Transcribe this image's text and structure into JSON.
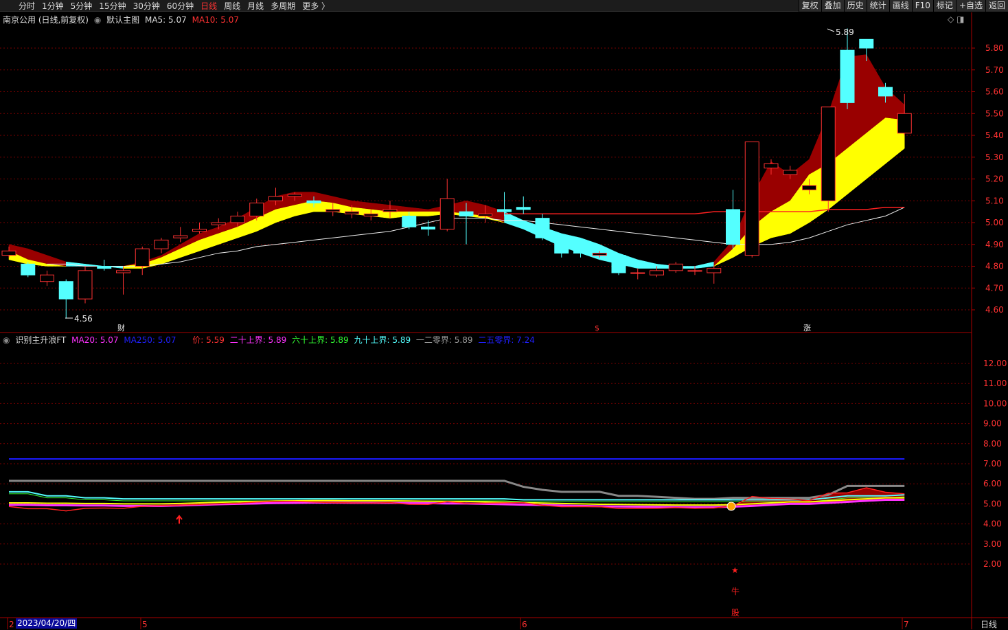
{
  "toolbar": {
    "left": [
      "分时",
      "1分钟",
      "5分钟",
      "15分钟",
      "30分钟",
      "60分钟",
      "日线",
      "周线",
      "月线",
      "多周期",
      "更多 〉"
    ],
    "active": "日线",
    "right": [
      "复权",
      "叠加",
      "历史",
      "统计",
      "画线",
      "F10",
      "标记",
      "+自选",
      "返回"
    ]
  },
  "main": {
    "stock": "南京公用 (日线,前复权)",
    "template": "默认主图",
    "ma5": "MA5: 5.07",
    "ma10": "MA10: 5.07",
    "high_label": "5.89",
    "low_label": "4.56",
    "markers": [
      "财",
      "$",
      "涨"
    ]
  },
  "indicator": {
    "name": "识别主升浪FT",
    "ma20": "MA20: 5.07",
    "ma250": "MA250: 5.07",
    "price": "价: 5.59",
    "l20": "二十上界: 5.89",
    "l60": "六十上界: 5.89",
    "l90": "九十上界: 5.89",
    "l120": "一二零界: 5.89",
    "l250": "二五零界: 7.24",
    "signals": [
      "★",
      "牛",
      "股"
    ]
  },
  "axis": {
    "date": "2023/04/20/四",
    "months": [
      "2",
      "5",
      "6",
      "7"
    ],
    "period": "日线"
  },
  "colors": {
    "up": "#ff3232",
    "down": "#54ffff",
    "band_up": "#990000",
    "band_mid": "#ffff00",
    "grid": "#7a0000"
  },
  "chart_data": {
    "type": "candlestick",
    "price_ticks": [
      "5.80",
      "5.70",
      "5.60",
      "5.50",
      "5.40",
      "5.30",
      "5.20",
      "5.10",
      "5.00",
      "4.90",
      "4.80",
      "4.70",
      "4.60"
    ],
    "ind_ticks": [
      "12.00",
      "11.00",
      "10.00",
      "9.00",
      "8.00",
      "7.00",
      "6.00",
      "5.00",
      "4.00",
      "3.00",
      "2.00"
    ],
    "ohlc": [
      [
        4.85,
        4.87,
        4.89,
        4.84
      ],
      [
        4.81,
        4.76,
        4.82,
        4.75
      ],
      [
        4.73,
        4.76,
        4.78,
        4.71
      ],
      [
        4.73,
        4.65,
        4.74,
        4.56
      ],
      [
        4.65,
        4.78,
        4.8,
        4.63
      ],
      [
        4.8,
        4.79,
        4.83,
        4.78
      ],
      [
        4.77,
        4.78,
        4.8,
        4.67
      ],
      [
        4.8,
        4.88,
        4.89,
        4.76
      ],
      [
        4.88,
        4.92,
        4.93,
        4.86
      ],
      [
        4.93,
        4.94,
        4.98,
        4.91
      ],
      [
        4.96,
        4.97,
        5.0,
        4.95
      ],
      [
        4.99,
        5.0,
        5.02,
        4.97
      ],
      [
        5.0,
        5.03,
        5.05,
        4.98
      ],
      [
        5.03,
        5.09,
        5.11,
        5.01
      ],
      [
        5.1,
        5.12,
        5.16,
        5.08
      ],
      [
        5.12,
        5.13,
        5.14,
        5.1
      ],
      [
        5.1,
        5.09,
        5.12,
        5.07
      ],
      [
        5.05,
        5.06,
        5.09,
        5.03
      ],
      [
        5.04,
        5.05,
        5.08,
        5.02
      ],
      [
        5.03,
        5.04,
        5.06,
        5.01
      ],
      [
        5.05,
        5.06,
        5.1,
        5.02
      ],
      [
        5.03,
        4.98,
        5.05,
        4.97
      ],
      [
        4.98,
        4.97,
        5.01,
        4.94
      ],
      [
        4.97,
        5.11,
        5.2,
        4.96
      ],
      [
        5.05,
        5.03,
        5.09,
        4.9
      ],
      [
        5.03,
        5.04,
        5.08,
        5.0
      ],
      [
        5.06,
        5.05,
        5.14,
        5.03
      ],
      [
        5.07,
        5.06,
        5.12,
        5.04
      ],
      [
        5.02,
        4.93,
        5.04,
        4.92
      ],
      [
        4.91,
        4.86,
        4.92,
        4.84
      ],
      [
        4.9,
        4.86,
        4.9,
        4.84
      ],
      [
        4.85,
        4.86,
        4.87,
        4.84
      ],
      [
        4.85,
        4.77,
        4.85,
        4.76
      ],
      [
        4.77,
        4.77,
        4.79,
        4.74
      ],
      [
        4.76,
        4.78,
        4.8,
        4.75
      ],
      [
        4.78,
        4.81,
        4.82,
        4.77
      ],
      [
        4.78,
        4.78,
        4.8,
        4.76
      ],
      [
        4.77,
        4.79,
        4.8,
        4.72
      ],
      [
        5.06,
        4.9,
        5.15,
        4.88
      ],
      [
        4.85,
        5.37,
        5.37,
        4.84
      ],
      [
        5.25,
        5.27,
        5.29,
        5.22
      ],
      [
        5.22,
        5.24,
        5.26,
        5.2
      ],
      [
        5.15,
        5.17,
        5.2,
        5.13
      ],
      [
        5.1,
        5.53,
        5.53,
        5.05
      ],
      [
        5.79,
        5.55,
        5.89,
        5.52
      ],
      [
        5.84,
        5.8,
        5.84,
        5.74
      ],
      [
        5.62,
        5.58,
        5.64,
        5.55
      ],
      [
        5.41,
        5.5,
        5.59,
        5.4
      ]
    ],
    "band_a": [
      4.9,
      4.88,
      4.85,
      4.82,
      4.81,
      4.8,
      4.8,
      4.82,
      4.85,
      4.9,
      4.95,
      4.98,
      5.02,
      5.07,
      5.12,
      5.14,
      5.14,
      5.12,
      5.1,
      5.09,
      5.08,
      5.07,
      5.06,
      5.08,
      5.1,
      5.08,
      5.05,
      5.01,
      4.98,
      4.95,
      4.93,
      4.9,
      4.86,
      4.83,
      4.81,
      4.8,
      4.8,
      4.82,
      4.92,
      5.12,
      5.28,
      5.22,
      5.29,
      5.5,
      5.76,
      5.77,
      5.62,
      5.54
    ],
    "band_b": [
      4.87,
      4.83,
      4.81,
      4.8,
      4.8,
      4.79,
      4.8,
      4.81,
      4.84,
      4.88,
      4.92,
      4.95,
      4.98,
      5.02,
      5.06,
      5.08,
      5.1,
      5.09,
      5.07,
      5.06,
      5.05,
      5.05,
      5.05,
      5.05,
      5.04,
      5.03,
      5.0,
      4.97,
      4.93,
      4.89,
      4.86,
      4.83,
      4.81,
      4.8,
      4.79,
      4.79,
      4.79,
      4.8,
      4.88,
      4.98,
      5.05,
      5.1,
      5.22,
      5.27,
      5.34,
      5.41,
      5.48,
      5.47
    ],
    "band_c": [
      4.83,
      4.81,
      4.8,
      4.8,
      4.8,
      4.8,
      4.79,
      4.79,
      4.81,
      4.84,
      4.87,
      4.9,
      4.93,
      4.96,
      5.0,
      5.03,
      5.05,
      5.05,
      5.04,
      5.03,
      5.02,
      5.03,
      5.03,
      5.04,
      5.03,
      5.02,
      5.0,
      4.97,
      4.93,
      4.89,
      4.86,
      4.83,
      4.81,
      4.79,
      4.79,
      4.79,
      4.79,
      4.8,
      4.84,
      4.89,
      4.93,
      4.95,
      5.0,
      5.06,
      5.13,
      5.2,
      5.27,
      5.34
    ],
    "trend_up": [
      1,
      1,
      1,
      0,
      0,
      0,
      1,
      1,
      1,
      1,
      1,
      1,
      1,
      1,
      1,
      1,
      1,
      1,
      1,
      1,
      1,
      1,
      1,
      1,
      1,
      1,
      0,
      0,
      0,
      0,
      0,
      0,
      0,
      0,
      0,
      0,
      0,
      1,
      1,
      1,
      1,
      1,
      1,
      1,
      1,
      1,
      1,
      1
    ],
    "ma_white": [
      null,
      null,
      4.81,
      4.81,
      4.8,
      4.8,
      4.8,
      4.8,
      4.81,
      4.82,
      4.84,
      4.86,
      4.87,
      4.89,
      4.9,
      4.91,
      4.92,
      4.93,
      4.94,
      4.95,
      4.96,
      4.98,
      5.0,
      5.02,
      5.02,
      5.02,
      5.01,
      5.01,
      5.0,
      4.99,
      4.98,
      4.97,
      4.96,
      4.95,
      4.94,
      4.93,
      4.92,
      4.91,
      4.9,
      4.9,
      4.9,
      4.91,
      4.93,
      4.96,
      4.99,
      5.01,
      5.03,
      5.07
    ],
    "ma_red": {
      "start": 26,
      "values": [
        5.04,
        5.04,
        5.04,
        5.04,
        5.04,
        5.04,
        5.04,
        5.04,
        5.04,
        5.04,
        5.04,
        5.05,
        5.05,
        5.05,
        5.05,
        5.05,
        5.05,
        5.06,
        5.06,
        5.06,
        5.07,
        5.07
      ]
    },
    "ind_blue": 7.24,
    "ind_gray": [
      6.15,
      6.15,
      6.15,
      6.15,
      6.15,
      6.15,
      6.15,
      6.15,
      6.15,
      6.15,
      6.15,
      6.15,
      6.15,
      6.15,
      6.15,
      6.15,
      6.15,
      6.15,
      6.15,
      6.15,
      6.15,
      6.15,
      6.15,
      6.15,
      6.15,
      6.15,
      6.15,
      5.85,
      5.7,
      5.6,
      5.6,
      5.6,
      5.4,
      5.4,
      5.35,
      5.3,
      5.25,
      5.25,
      5.3,
      5.3,
      5.3,
      5.3,
      5.3,
      5.45,
      5.89,
      5.89,
      5.89,
      5.89
    ],
    "ind_cyan": [
      5.6,
      5.6,
      5.4,
      5.4,
      5.3,
      5.3,
      5.25,
      5.25,
      5.25,
      5.25,
      5.25,
      5.25,
      5.25,
      5.25,
      5.25,
      5.25,
      5.25,
      5.25,
      5.25,
      5.25,
      5.25,
      5.25,
      5.25,
      5.25,
      5.25,
      5.25,
      5.25,
      5.2,
      5.2,
      5.2,
      5.2,
      5.2,
      5.2,
      5.2,
      5.2,
      5.2,
      5.2,
      5.2,
      5.2,
      5.2,
      5.2,
      5.2,
      5.2,
      5.3,
      5.4,
      5.4,
      5.4,
      5.45
    ],
    "ind_magenta": [
      4.95,
      4.95,
      4.93,
      4.93,
      4.92,
      4.92,
      4.9,
      4.9,
      4.9,
      4.92,
      4.95,
      4.98,
      5.0,
      5.02,
      5.04,
      5.05,
      5.06,
      5.06,
      5.05,
      5.05,
      5.05,
      5.04,
      5.03,
      5.02,
      5.02,
      5.0,
      4.98,
      4.96,
      4.94,
      4.92,
      4.9,
      4.88,
      4.87,
      4.86,
      4.85,
      4.84,
      4.84,
      4.84,
      4.86,
      4.9,
      4.95,
      5.0,
      5.0,
      5.05,
      5.1,
      5.15,
      5.2,
      5.2
    ],
    "ind_price": [
      4.87,
      4.76,
      4.76,
      4.65,
      4.78,
      4.79,
      4.78,
      4.88,
      4.92,
      4.94,
      4.97,
      5.0,
      5.03,
      5.09,
      5.12,
      5.13,
      5.09,
      5.06,
      5.05,
      5.04,
      5.06,
      4.98,
      4.97,
      5.11,
      5.03,
      5.04,
      5.05,
      5.06,
      4.93,
      4.86,
      4.86,
      4.86,
      4.77,
      4.77,
      4.78,
      4.81,
      4.78,
      4.79,
      4.9,
      5.37,
      5.27,
      5.24,
      5.17,
      5.53,
      5.55,
      5.8,
      5.58,
      5.5
    ]
  }
}
